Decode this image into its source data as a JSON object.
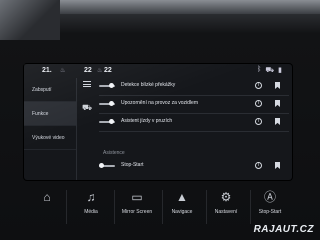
{
  "statusbar": {
    "temp_left": "21.",
    "temp_right": "22",
    "temp_right2": "22"
  },
  "sidebar": {
    "items": [
      {
        "label": "Zabsputí",
        "active": false
      },
      {
        "label": "Funkce",
        "active": true
      },
      {
        "label": "Výukové video",
        "active": false
      }
    ]
  },
  "settings": {
    "rows": [
      {
        "label": "Detekce blízké překážky",
        "on": true
      },
      {
        "label": "Upozornění na provoz za vozidlem",
        "on": true
      },
      {
        "label": "Asistent jízdy v pruzích",
        "on": true
      },
      {
        "label": "Stop-Start",
        "on": false
      }
    ],
    "section_label": "Asistence"
  },
  "hardware_buttons": [
    {
      "icon": "home-icon",
      "label": ""
    },
    {
      "icon": "music-note-icon",
      "label": "Média"
    },
    {
      "icon": "mirror-screen-icon",
      "label": "Mirror Screen"
    },
    {
      "icon": "navigation-arrow-icon",
      "label": "Navigace"
    },
    {
      "icon": "gear-icon",
      "label": "Nastavení"
    },
    {
      "icon": "stop-start-icon",
      "label": "Stop-Start"
    }
  ],
  "watermark": "RAJAUT.CZ",
  "colors": {
    "screen_bg": "#15171b",
    "toggle_knob": "#f2f4f7",
    "active_item_bg": "#2a2d33"
  }
}
